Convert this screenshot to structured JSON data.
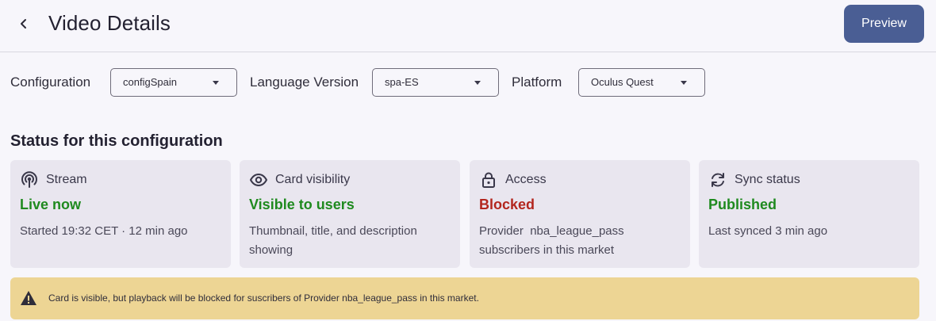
{
  "header": {
    "title": "Video Details",
    "preview_label": "Preview"
  },
  "filters": {
    "configuration": {
      "label": "Configuration",
      "value": "configSpain"
    },
    "language": {
      "label": "Language Version",
      "value": "spa-ES"
    },
    "platform": {
      "label": "Platform",
      "value": "Oculus Quest"
    }
  },
  "status": {
    "title": "Status for this configuration",
    "cards": [
      {
        "icon": "broadcast-icon",
        "label": "Stream",
        "state": "Live now",
        "state_color": "#1f8a1f",
        "desc": "Started 19:32 CET · 12 min ago"
      },
      {
        "icon": "eye-icon",
        "label": "Card visibility",
        "state": "Visible to users",
        "state_color": "#1f8a1f",
        "desc": "Thumbnail, title, and description showing"
      },
      {
        "icon": "lock-icon",
        "label": "Access",
        "state": "Blocked",
        "state_color": "#b3261e",
        "desc": "Provider  nba_league_pass subscribers in this market"
      },
      {
        "icon": "sync-icon",
        "label": "Sync status",
        "state": "Published",
        "state_color": "#1f8a1f",
        "desc": "Last synced 3 min ago"
      }
    ]
  },
  "alert": {
    "icon": "warning-icon",
    "message": "Card is visible, but playback will be blocked for suscribers of Provider nba_league_pass in this market."
  }
}
